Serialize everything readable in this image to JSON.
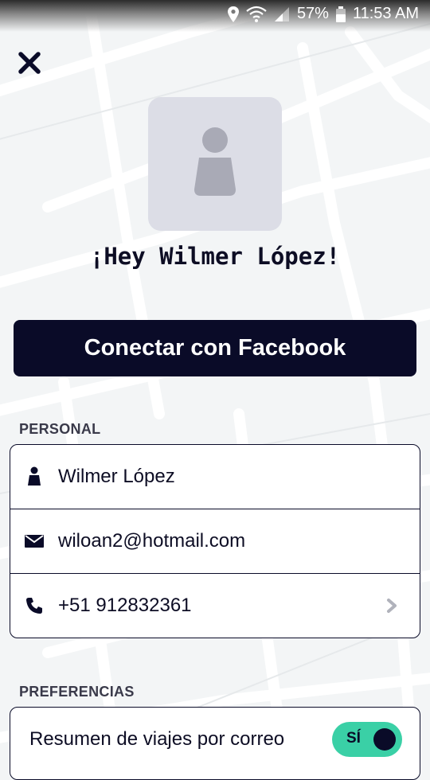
{
  "status_bar": {
    "battery": "57%",
    "time": "11:53 AM"
  },
  "profile": {
    "greeting": "¡Hey Wilmer López!"
  },
  "facebook_button": {
    "label": "Conectar con Facebook"
  },
  "personal": {
    "section_label": "PERSONAL",
    "name": "Wilmer López",
    "email": "wiloan2@hotmail.com",
    "phone": "+51 912832361"
  },
  "preferences": {
    "section_label": "PREFERENCIAS",
    "trip_summary_label": "Resumen de viajes por correo",
    "trip_summary_toggle": "SÍ"
  },
  "colors": {
    "primary_dark": "#0a0b28",
    "accent_green": "#3ad0a6",
    "avatar_bg": "#dcdde6",
    "avatar_icon": "#a9aab6"
  },
  "icons": {
    "close": "close-icon",
    "avatar_placeholder": "person-icon",
    "name": "person-icon",
    "email": "mail-icon",
    "phone": "phone-icon",
    "chevron": "chevron-right-icon"
  }
}
